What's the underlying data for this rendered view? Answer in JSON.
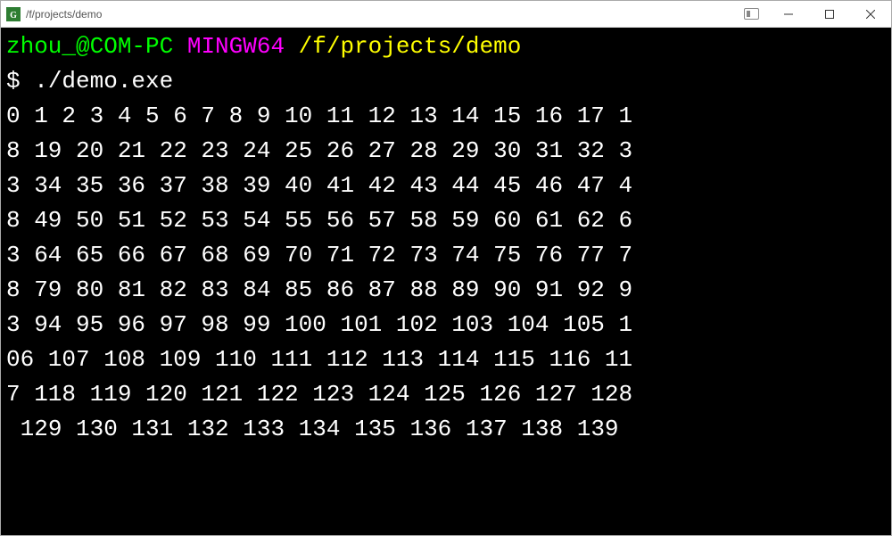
{
  "window": {
    "title": "/f/projects/demo"
  },
  "terminal": {
    "prompt": {
      "user_host": "zhou_@COM-PC",
      "env": "MINGW64",
      "path": "/f/projects/demo",
      "symbol": "$"
    },
    "command": "./demo.exe",
    "output_lines": [
      "0 1 2 3 4 5 6 7 8 9 10 11 12 13 14 15 16 17 1",
      "8 19 20 21 22 23 24 25 26 27 28 29 30 31 32 3",
      "3 34 35 36 37 38 39 40 41 42 43 44 45 46 47 4",
      "8 49 50 51 52 53 54 55 56 57 58 59 60 61 62 6",
      "3 64 65 66 67 68 69 70 71 72 73 74 75 76 77 7",
      "8 79 80 81 82 83 84 85 86 87 88 89 90 91 92 9",
      "3 94 95 96 97 98 99 100 101 102 103 104 105 1",
      "06 107 108 109 110 111 112 113 114 115 116 11",
      "7 118 119 120 121 122 123 124 125 126 127 128",
      " 129 130 131 132 133 134 135 136 137 138 139"
    ]
  }
}
